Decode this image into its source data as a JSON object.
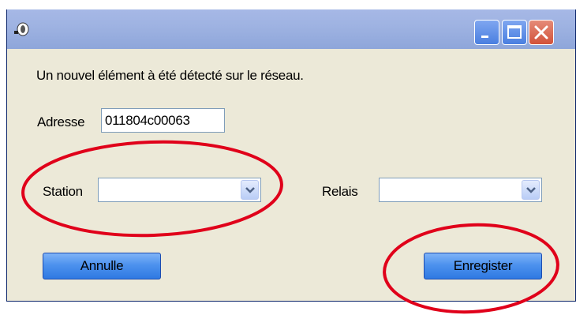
{
  "window": {
    "title": "",
    "icons": {
      "app": "app-bell-icon",
      "minimize": "minimize-icon",
      "maximize": "maximize-icon",
      "close": "close-icon"
    }
  },
  "dialog": {
    "message": "Un nouvel élément à été détecté sur le réseau.",
    "adresse_label": "Adresse",
    "adresse_value": "011804c00063",
    "station_label": "Station",
    "station_value": "",
    "relais_label": "Relais",
    "relais_value": "",
    "dropdown_icon": "chevron-down-icon",
    "annule_label": "Annulle",
    "enregistrer_label": "Enregister"
  },
  "colors": {
    "dialog_bg": "#ece9d8",
    "titlebar": "#9fb3e2",
    "button_blue": "#4d92ee",
    "close_red": "#d2523a",
    "annotation_red": "#e0001a"
  }
}
